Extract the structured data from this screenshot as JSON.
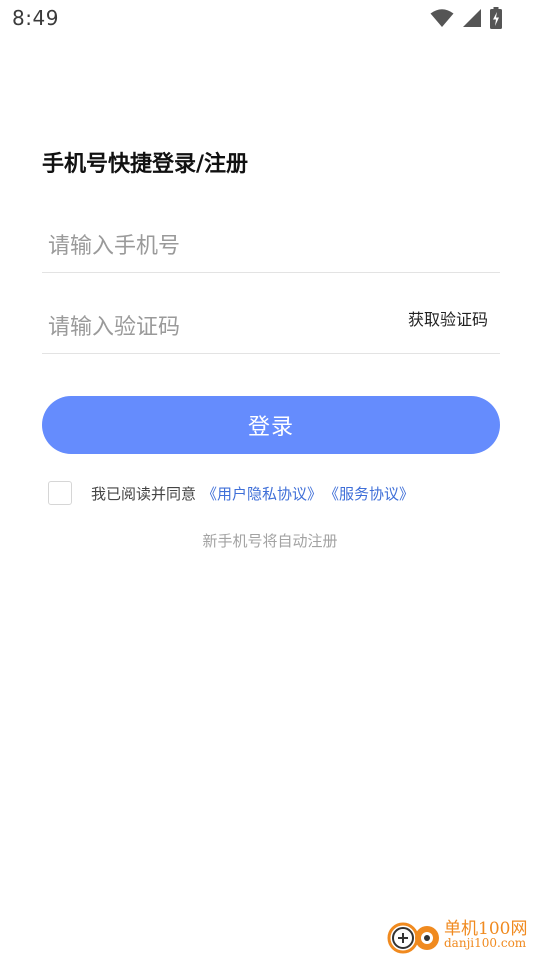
{
  "status_bar": {
    "time": "8:49",
    "icons": [
      "wifi-icon",
      "signal-icon",
      "battery-charging-icon"
    ]
  },
  "login": {
    "title": "手机号快捷登录/注册",
    "phone_placeholder": "请输入手机号",
    "phone_value": "",
    "code_placeholder": "请输入验证码",
    "code_value": "",
    "get_code_label": "获取验证码",
    "submit_label": "登录",
    "agreement": {
      "checked": false,
      "prefix": "我已阅读并同意",
      "privacy_link": "《用户隐私协议》",
      "service_link": "《服务协议》"
    },
    "register_hint": "新手机号将自动注册"
  },
  "watermark": {
    "title": "单机100网",
    "domain": "danji100.com"
  },
  "colors": {
    "accent": "#658cfd",
    "link": "#3f6fd8",
    "watermark": "#f08a1f"
  }
}
